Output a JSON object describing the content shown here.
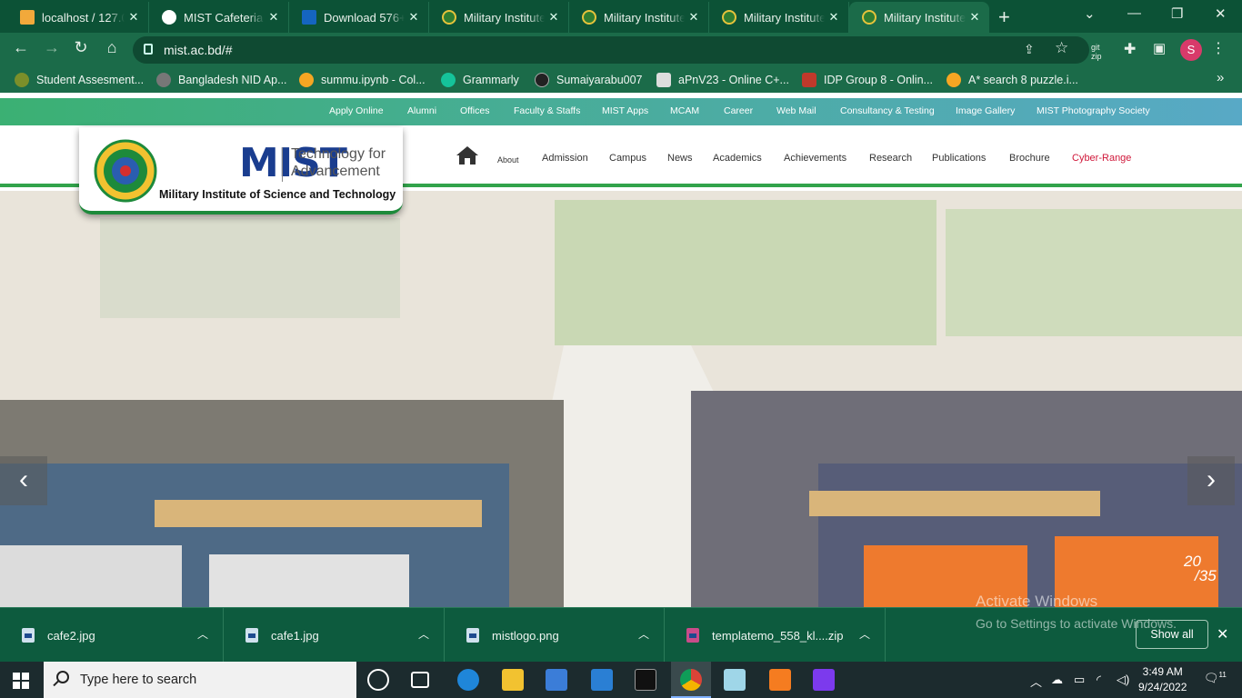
{
  "browser": {
    "tabs": [
      {
        "title": "localhost / 127.0",
        "color": "#f2a93b"
      },
      {
        "title": "MIST Cafeteria Wiki",
        "color": "#ffffff"
      },
      {
        "title": "Download 576+",
        "color": "#1565c0"
      },
      {
        "title": "Military Institute",
        "color": "#2e7d32"
      },
      {
        "title": "Military Institute",
        "color": "#2e7d32"
      },
      {
        "title": "Military Institute",
        "color": "#2e7d32"
      },
      {
        "title": "Military Institute",
        "color": "#2e7d32"
      }
    ],
    "url": "mist.ac.bd/#",
    "profile_initial": "S",
    "bookmarks": [
      {
        "label": "Student Assesment...",
        "color": "#7b8f2a"
      },
      {
        "label": "Bangladesh NID Ap...",
        "color": "#777777"
      },
      {
        "label": "summu.ipynb - Col...",
        "color": "#f5a623"
      },
      {
        "label": "Grammarly",
        "color": "#15c39a"
      },
      {
        "label": "Sumaiyarabu007",
        "color": "#222222"
      },
      {
        "label": "aPnV23 - Online C+...",
        "color": "#dddddd"
      },
      {
        "label": "IDP Group 8 - Onlin...",
        "color": "#c0392b"
      },
      {
        "label": "A* search 8 puzzle.i...",
        "color": "#f5a623"
      }
    ],
    "bookmarks_overflow": "»"
  },
  "site": {
    "top_links": [
      "Apply Online",
      "Alumni",
      "Offices",
      "Faculty & Staffs",
      "MIST Apps",
      "MCAM",
      "Career",
      "Web Mail",
      "Consultancy & Testing",
      "Image Gallery",
      "MIST Photography Society"
    ],
    "logo": {
      "acronym": "MIST",
      "tagline_1": "Technology for",
      "tagline_2": "Advancement",
      "full_name": "Military Institute of Science and Technology"
    },
    "nav": [
      "About",
      "Admission",
      "Campus",
      "News",
      "Academics",
      "Achievements",
      "Research",
      "Publications",
      "Brochure",
      "Cyber-Range"
    ],
    "slider": {
      "prev": "‹",
      "next": "›",
      "current": "20",
      "total": "35"
    },
    "activation_title": "Activate Windows",
    "activation_sub": "Go to Settings to activate Windows."
  },
  "downloads": {
    "items": [
      "cafe2.jpg",
      "cafe1.jpg",
      "mistlogo.png",
      "templatemo_558_kl....zip"
    ],
    "show_all": "Show all"
  },
  "taskbar": {
    "search_placeholder": "Type here to search",
    "time": "3:49 AM",
    "date": "9/24/2022",
    "notifications": "11"
  }
}
